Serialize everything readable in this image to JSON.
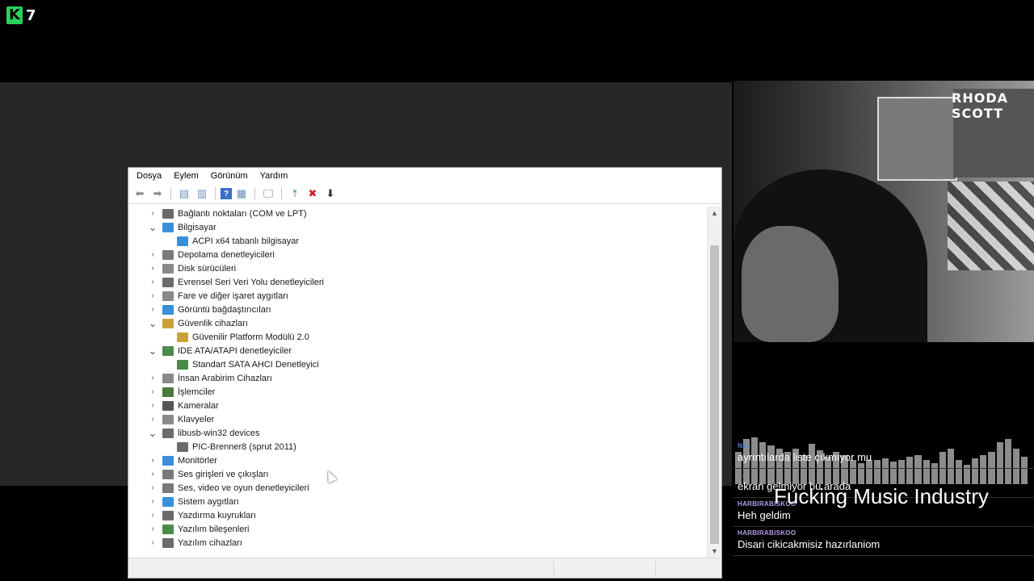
{
  "logo": {
    "letter": "K",
    "number": "7",
    "accent": "#27d35a"
  },
  "device_manager": {
    "menu": [
      "Dosya",
      "Eylem",
      "Görünüm",
      "Yardım"
    ],
    "toolbar_icons": [
      "back-arrow-icon",
      "forward-arrow-icon",
      "properties-view-icon",
      "details-icon",
      "help-icon",
      "panel-icon",
      "monitor-icon",
      "update-driver-icon",
      "uninstall-icon",
      "download-icon"
    ],
    "tree": [
      {
        "label": "Bağlantı noktaları (COM ve LPT)",
        "expanded": false,
        "child": false,
        "icon": "port-icon",
        "color": "#6b6b6b"
      },
      {
        "label": "Bilgisayar",
        "expanded": true,
        "child": false,
        "icon": "computer-icon",
        "color": "#3a8fd8"
      },
      {
        "label": "ACPI x64 tabanlı bilgisayar",
        "expanded": false,
        "child": true,
        "icon": "computer-icon",
        "color": "#3a8fd8"
      },
      {
        "label": "Depolama denetleyicileri",
        "expanded": false,
        "child": false,
        "icon": "storage-icon",
        "color": "#7a7a7a"
      },
      {
        "label": "Disk sürücüleri",
        "expanded": false,
        "child": false,
        "icon": "disk-icon",
        "color": "#8a8a8a"
      },
      {
        "label": "Evrensel Seri Veri Yolu denetleyicileri",
        "expanded": false,
        "child": false,
        "icon": "usb-icon",
        "color": "#6b6b6b"
      },
      {
        "label": "Fare ve diğer işaret aygıtları",
        "expanded": false,
        "child": false,
        "icon": "mouse-icon",
        "color": "#8a8a8a"
      },
      {
        "label": "Görüntü bağdaştırıcıları",
        "expanded": false,
        "child": false,
        "icon": "display-icon",
        "color": "#3a8fd8"
      },
      {
        "label": "Güvenlik cihazları",
        "expanded": true,
        "child": false,
        "icon": "security-icon",
        "color": "#c9a23a"
      },
      {
        "label": "Güvenilir Platform Modülü 2.0",
        "expanded": false,
        "child": true,
        "icon": "security-icon",
        "color": "#c9a23a"
      },
      {
        "label": "IDE ATA/ATAPI denetleyiciler",
        "expanded": true,
        "child": false,
        "icon": "ide-icon",
        "color": "#4a8a4a"
      },
      {
        "label": "Standart SATA AHCI Denetleyici",
        "expanded": false,
        "child": true,
        "icon": "ide-icon",
        "color": "#4a8a4a"
      },
      {
        "label": "İnsan Arabirim Cihazları",
        "expanded": false,
        "child": false,
        "icon": "hid-icon",
        "color": "#8a8a8a"
      },
      {
        "label": "İşlemciler",
        "expanded": false,
        "child": false,
        "icon": "cpu-icon",
        "color": "#4a7a3a"
      },
      {
        "label": "Kameralar",
        "expanded": false,
        "child": false,
        "icon": "camera-icon",
        "color": "#555555"
      },
      {
        "label": "Klavyeler",
        "expanded": false,
        "child": false,
        "icon": "keyboard-icon",
        "color": "#8a8a8a"
      },
      {
        "label": "libusb-win32 devices",
        "expanded": true,
        "child": false,
        "icon": "usb-icon",
        "color": "#6b6b6b"
      },
      {
        "label": "PIC-Brenner8  (sprut 2011)",
        "expanded": false,
        "child": true,
        "icon": "usb-icon",
        "color": "#6b6b6b"
      },
      {
        "label": "Monitörler",
        "expanded": false,
        "child": false,
        "icon": "monitor-icon",
        "color": "#3a8fd8"
      },
      {
        "label": "Ses girişleri ve çıkışları",
        "expanded": false,
        "child": false,
        "icon": "speaker-icon",
        "color": "#7a7a7a"
      },
      {
        "label": "Ses, video ve oyun denetleyicileri",
        "expanded": false,
        "child": false,
        "icon": "speaker-icon",
        "color": "#7a7a7a"
      },
      {
        "label": "Sistem aygıtları",
        "expanded": false,
        "child": false,
        "icon": "system-icon",
        "color": "#3a8fd8"
      },
      {
        "label": "Yazdırma kuyrukları",
        "expanded": false,
        "child": false,
        "icon": "printer-icon",
        "color": "#6b6b6b"
      },
      {
        "label": "Yazılım bileşenleri",
        "expanded": false,
        "child": false,
        "icon": "software-icon",
        "color": "#4a8a4a"
      },
      {
        "label": "Yazılım cihazları",
        "expanded": false,
        "child": false,
        "icon": "software-device-icon",
        "color": "#6b6b6b"
      }
    ]
  },
  "webcam": {
    "poster_text": "RHODA SCOTT"
  },
  "overlay": {
    "title": "Fucking Music Industry"
  },
  "chat": [
    {
      "user": "NE...",
      "user_color": "#4a7fd0",
      "text": "ayrıntılarda liste çıkmıyor mu"
    },
    {
      "user": "...",
      "user_color": "#4a7fd0",
      "text": "ekran gelmiyor bu arada"
    },
    {
      "user": "HARBIRABISKOO",
      "user_color": "#b49ce8",
      "text": "Heh geldim"
    },
    {
      "user": "HARBIRABISKOO",
      "user_color": "#b49ce8",
      "text": "Disari cikicakmisiz hazırlaniom"
    }
  ]
}
